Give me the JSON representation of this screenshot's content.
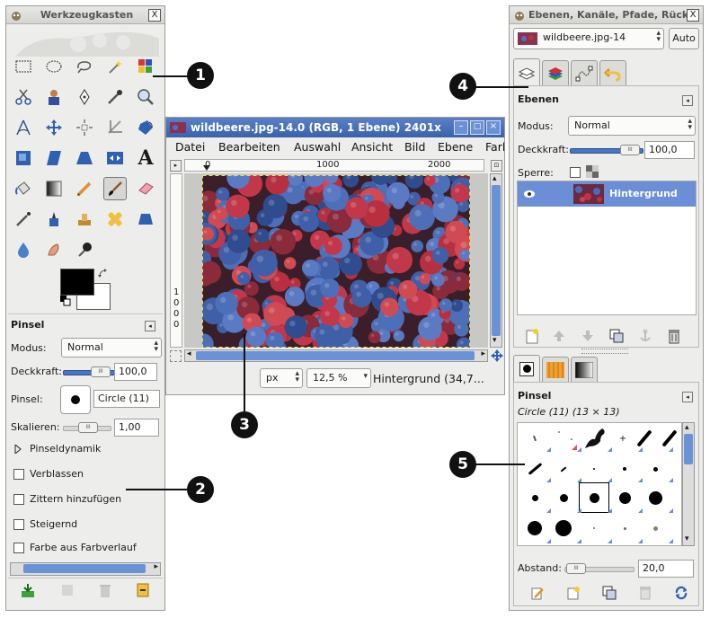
{
  "toolbox": {
    "title": "Werkzeugkasten",
    "close": "X",
    "brush_options_title": "Pinsel",
    "mode_label": "Modus:",
    "mode_value": "Normal",
    "opacity_label": "Deckkraft:",
    "opacity_value": "100,0",
    "brush_label": "Pinsel:",
    "brush_value": "Circle (11)",
    "scale_label": "Skalieren:",
    "scale_value": "1,00",
    "dynamics_label": "Pinseldynamik",
    "options": [
      "Verblassen",
      "Zittern hinzufügen",
      "Steigernd",
      "Farbe aus Farbverlauf"
    ]
  },
  "image_window": {
    "title": "wildbeere.jpg-14.0 (RGB, 1 Ebene) 2401x",
    "menu": [
      "Datei",
      "Bearbeiten",
      "Auswahl",
      "Ansicht",
      "Bild",
      "Ebene",
      "Farb"
    ],
    "ruler_ticks": [
      "0",
      "1000",
      "2000"
    ],
    "vruler_ticks": [
      "1",
      "0",
      "0",
      "0"
    ],
    "unit": "px",
    "zoom": "12,5 %",
    "status": "Hintergrund (34,7..."
  },
  "layers_dock": {
    "title": "Ebenen, Kanäle, Pfade, Rückg",
    "close": "X",
    "image_select": "wildbeere.jpg-14",
    "auto_button": "Auto",
    "section_title": "Ebenen",
    "mode_label": "Modus:",
    "mode_value": "Normal",
    "opacity_label": "Deckkraft:",
    "opacity_value": "100,0",
    "lock_label": "Sperre:",
    "layer_name": "Hintergrund"
  },
  "brushes_dock": {
    "section_title": "Pinsel",
    "brush_info": "Circle (11) (13 × 13)",
    "spacing_label": "Abstand:",
    "spacing_value": "20,0"
  },
  "callouts": [
    "1",
    "2",
    "3",
    "4",
    "5"
  ],
  "colors": {
    "accent_blue": "#4a74c4",
    "selected_layer": "#6b8ed6",
    "foreground": "#000000",
    "background": "#ffffff"
  }
}
